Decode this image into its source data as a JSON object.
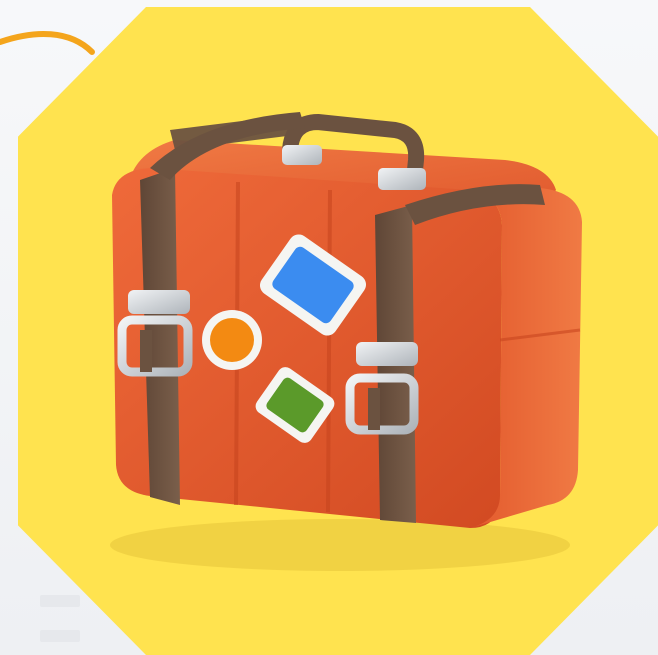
{
  "scene": {
    "subject": "suitcase-icon",
    "colors": {
      "background": "#f3f4f6",
      "badge": "#ffe34f",
      "swoosh": "#f4a51c",
      "case_body": "#e2542c",
      "case_side": "#c9461f",
      "strap": "#6b5240",
      "buckle": "#cfd4d8",
      "sticker_blue": "#3b8cf0",
      "sticker_orange": "#f38a12",
      "sticker_green": "#5b9a2a"
    }
  }
}
